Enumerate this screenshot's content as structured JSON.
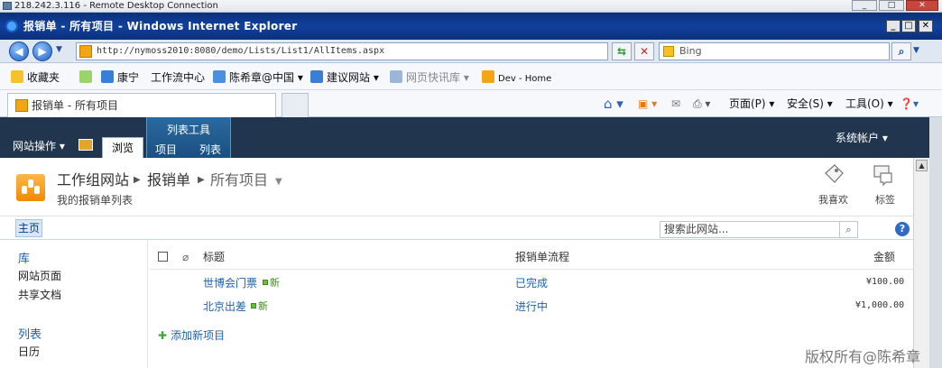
{
  "rdp": {
    "title": "218.242.3.116 - Remote Desktop Connection",
    "minimize": "_",
    "maximize": "□",
    "close": "✕"
  },
  "window": {
    "title": "报销单 - 所有项目 - Windows Internet Explorer",
    "min": "_",
    "max": "□",
    "close": "✕"
  },
  "address": {
    "url": "http://nymoss2010:8080/demo/Lists/List1/AllItems.aspx",
    "search_placeholder": "Bing"
  },
  "favorites": {
    "label": "收藏夹",
    "items": [
      "康宁",
      "工作流中心",
      "陈希章@中国 ▾",
      "建议网站 ▾",
      "网页快讯库 ▾",
      "Dev - Home"
    ]
  },
  "tab": {
    "title": "报销单 - 所有项目"
  },
  "commandbar": {
    "page": "页面(P) ▾",
    "safety": "安全(S) ▾",
    "tools": "工具(O) ▾"
  },
  "ribbon": {
    "site_actions": "网站操作 ▾",
    "browse": "浏览",
    "context_group": "列表工具",
    "tab_items": "项目",
    "tab_list": "列表",
    "user": "系统帐户 ▾"
  },
  "header": {
    "crumb_site": "工作组网站",
    "crumb_list": "报销单",
    "crumb_view": "所有项目",
    "description": "我的报销单列表",
    "like_label": "我喜欢",
    "tags_label": "标签"
  },
  "topnav": {
    "home": "主页",
    "search_placeholder": "搜索此网站..."
  },
  "quicklaunch": {
    "libraries_heading": "库",
    "libraries": [
      "网站页面",
      "共享文档"
    ],
    "lists_heading": "列表",
    "lists": [
      "日历"
    ]
  },
  "list": {
    "columns": {
      "title": "标题",
      "workflow": "报销单流程",
      "amount": "金额"
    },
    "rows": [
      {
        "title": "世博会门票",
        "new": "新",
        "workflow": "已完成",
        "amount": "¥100.00"
      },
      {
        "title": "北京出差",
        "new": "新",
        "workflow": "进行中",
        "amount": "¥1,000.00"
      }
    ],
    "add_new": "添加新项目"
  },
  "watermark": "版权所有@陈希章",
  "colors": {
    "ribbon": "#21354f",
    "link": "#1f62a8",
    "ie_title": "#0b2f7a"
  }
}
